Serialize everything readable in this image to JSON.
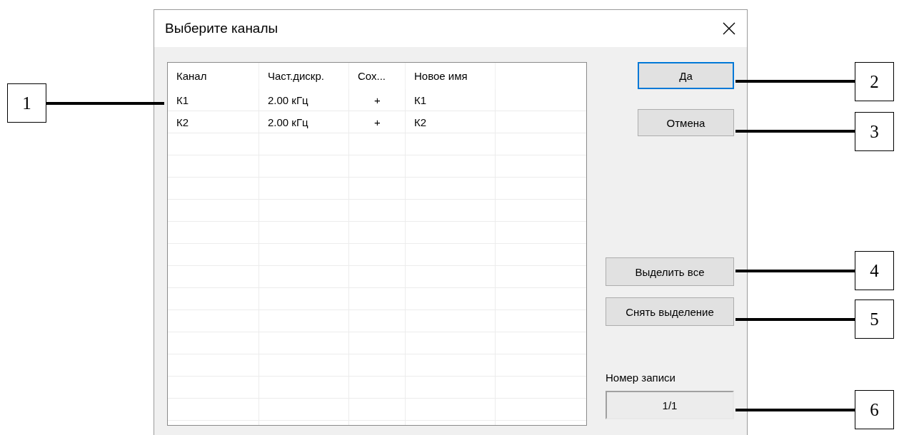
{
  "window": {
    "title": "Выберите каналы"
  },
  "table": {
    "columns": [
      "Канал",
      "Част.дискр.",
      "Сох...",
      "Новое имя"
    ],
    "rows": [
      [
        "К1",
        "2.00 кГц",
        "+",
        "К1"
      ],
      [
        "К2",
        "2.00 кГц",
        "+",
        "К2"
      ]
    ]
  },
  "buttons": [
    {
      "label": "Да",
      "focused": true
    },
    {
      "label": "Отмена",
      "focused": false
    }
  ],
  "selection_buttons": [
    {
      "label": "Выделить все"
    },
    {
      "label": "Снять выделение"
    }
  ],
  "record": {
    "label": "Номер записи",
    "value": "1/1"
  },
  "callouts": [
    {
      "label": "1"
    },
    {
      "label": "2"
    },
    {
      "label": "3"
    },
    {
      "label": "4"
    },
    {
      "label": "5"
    },
    {
      "label": "6"
    }
  ]
}
